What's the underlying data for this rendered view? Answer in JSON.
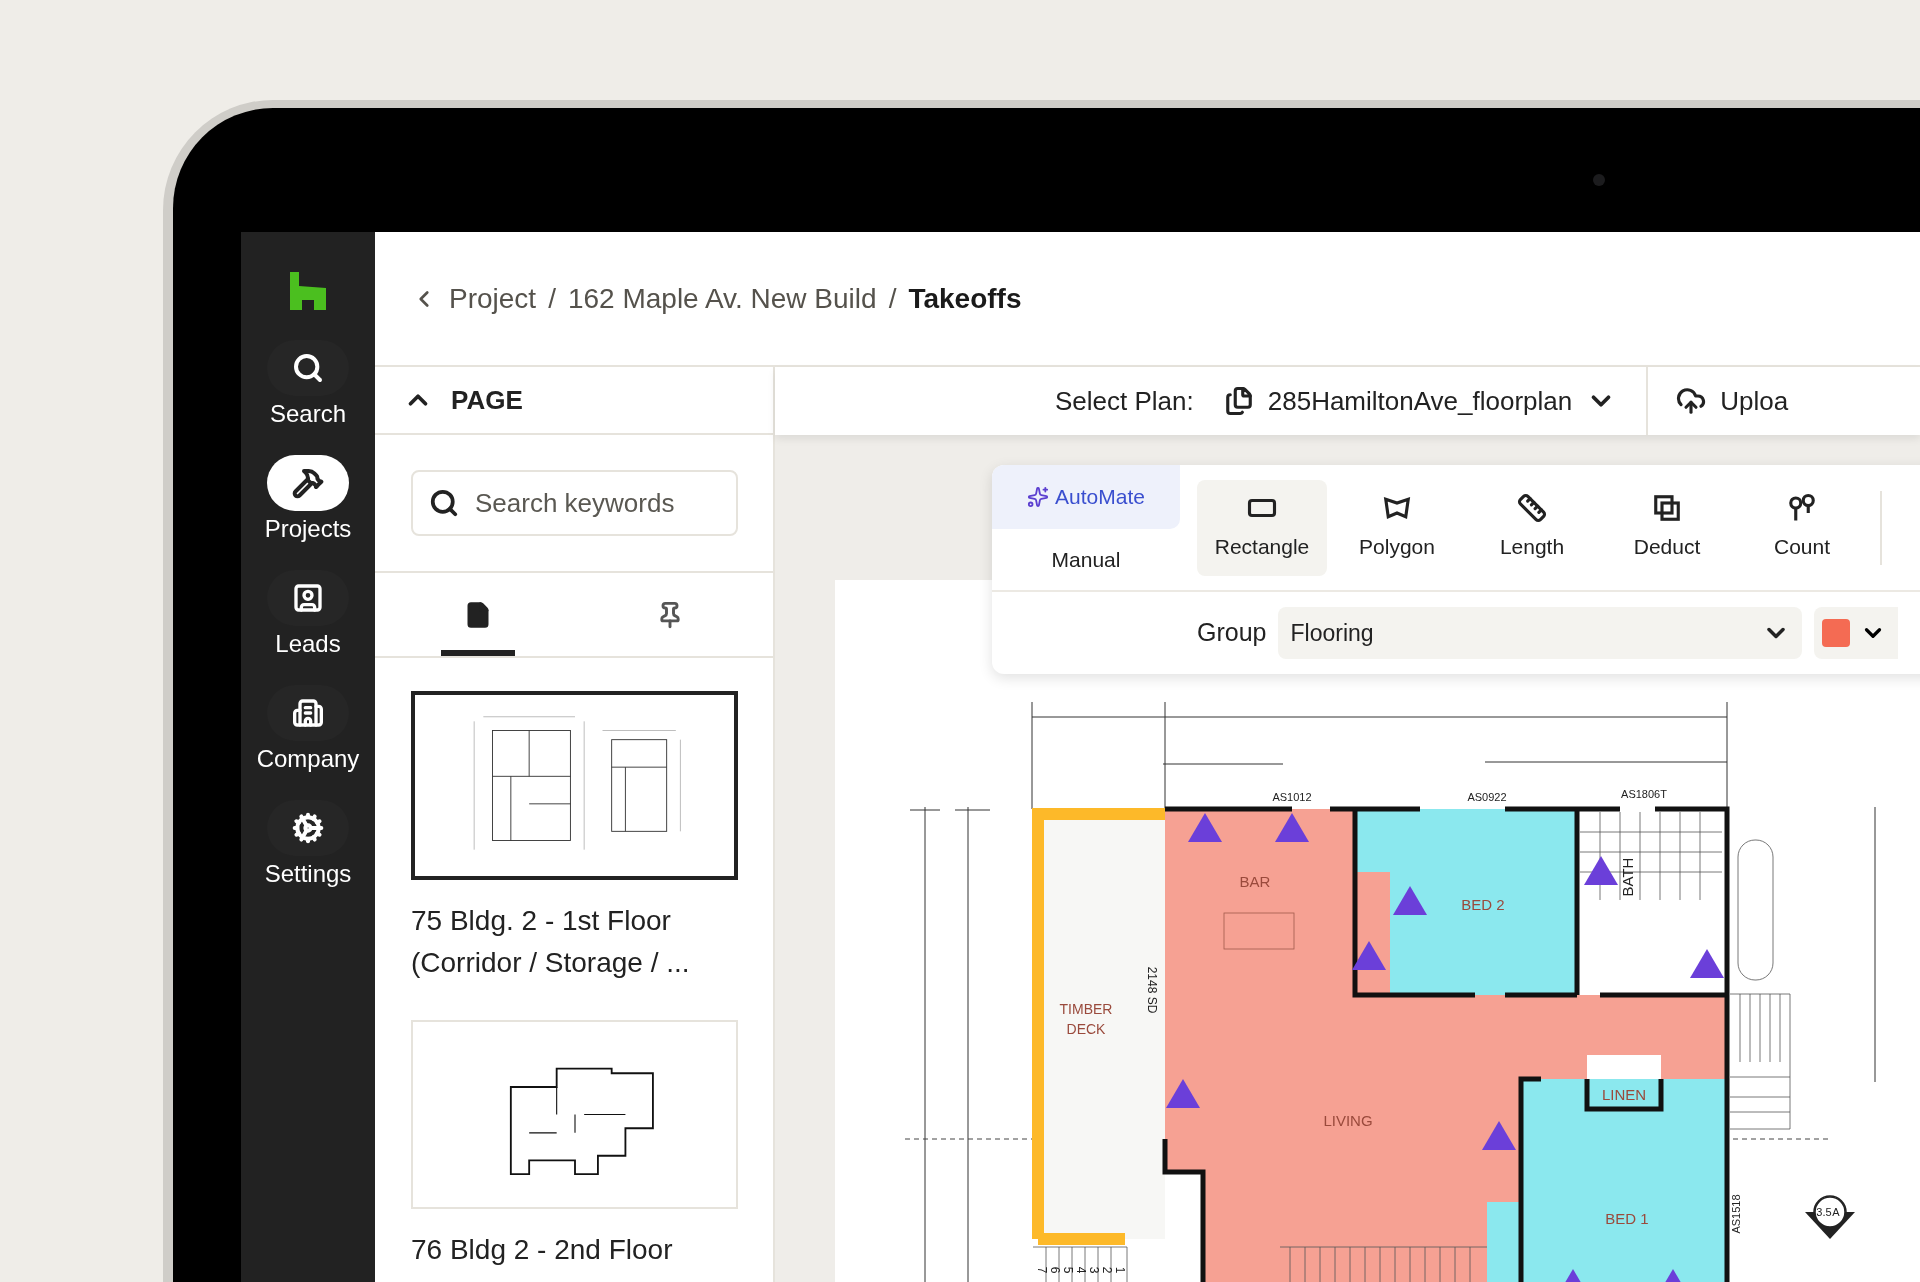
{
  "nav": {
    "items": [
      {
        "label": "Search",
        "selected": false
      },
      {
        "label": "Projects",
        "selected": true
      },
      {
        "label": "Leads",
        "selected": false
      },
      {
        "label": "Company",
        "selected": false
      },
      {
        "label": "Settings",
        "selected": false
      }
    ]
  },
  "breadcrumb": {
    "items": [
      "Project",
      "162 Maple Av. New Build",
      "Takeoffs"
    ],
    "separator": "/"
  },
  "page_panel": {
    "title": "PAGE",
    "expanded": true,
    "search": {
      "placeholder": "Search keywords"
    },
    "tabs": [
      {
        "kind": "pages",
        "selected": true
      },
      {
        "kind": "pinned",
        "selected": false
      }
    ],
    "pages": [
      {
        "caption": "75 Bldg. 2 - 1st Floor (Corridor / Storage / ...",
        "selected": true
      },
      {
        "caption": "76 Bldg 2 - 2nd Floor",
        "selected": false
      }
    ]
  },
  "plan_bar": {
    "label": "Select Plan:",
    "plan": "285HamiltonAve_floorplan",
    "upload": "Uploa"
  },
  "toolbar": {
    "modes": [
      {
        "label": "AutoMate",
        "selected": true
      },
      {
        "label": "Manual",
        "selected": false
      }
    ],
    "tools": [
      {
        "kind": "rectangle",
        "label": "Rectangle",
        "selected": true
      },
      {
        "kind": "polygon",
        "label": "Polygon",
        "selected": false
      },
      {
        "kind": "length",
        "label": "Length",
        "selected": false
      },
      {
        "kind": "deduct",
        "label": "Deduct",
        "selected": false
      },
      {
        "kind": "count",
        "label": "Count",
        "selected": false
      }
    ],
    "group_label": "Group",
    "group": "Flooring",
    "color": "#f46b53"
  },
  "floor_plan": {
    "labels": [
      {
        "kind": "room",
        "text": "BAR"
      },
      {
        "kind": "room",
        "text": "BED 2"
      },
      {
        "kind": "room",
        "text": "TIMBER"
      },
      {
        "kind": "room",
        "text": "DECK"
      },
      {
        "kind": "room",
        "text": "LIVING"
      },
      {
        "kind": "room",
        "text": "LINEN"
      },
      {
        "kind": "room",
        "text": "BED 1"
      },
      {
        "kind": "vertical",
        "text": "BATH"
      },
      {
        "kind": "vertical",
        "text": "2148 SD"
      },
      {
        "kind": "tag",
        "text": "AS1012"
      },
      {
        "kind": "tag",
        "text": "AS0922"
      },
      {
        "kind": "tag",
        "text": "AS1806T"
      },
      {
        "kind": "vertical",
        "text": "AS1518"
      }
    ],
    "stair_numbers": [
      "1",
      "2",
      "3",
      "4",
      "5",
      "6",
      "7"
    ],
    "section_marker": {
      "letter": "A",
      "sheet": "3.5"
    }
  }
}
